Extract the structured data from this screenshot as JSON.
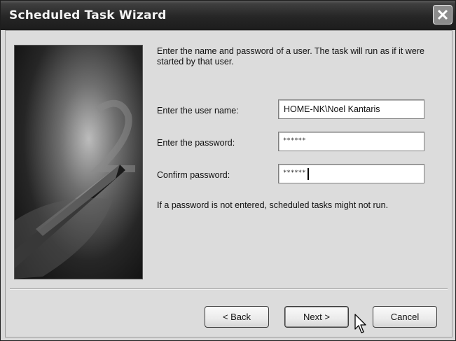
{
  "window": {
    "title": "Scheduled Task Wizard"
  },
  "instructions": "Enter the name and password of a user.  The task will run as if it were started by that user.",
  "form": {
    "username": {
      "label": "Enter the user name:",
      "value": "HOME-NK\\Noel Kantaris"
    },
    "password": {
      "label": "Enter the password:",
      "value": "******"
    },
    "confirm": {
      "label": "Confirm password:",
      "value": "******"
    }
  },
  "note": "If a password is not entered, scheduled tasks might not run.",
  "buttons": {
    "back": "< Back",
    "next": "Next >",
    "cancel": "Cancel"
  },
  "icons": {
    "close": "close-icon",
    "cursor": "mouse-pointer-icon"
  }
}
